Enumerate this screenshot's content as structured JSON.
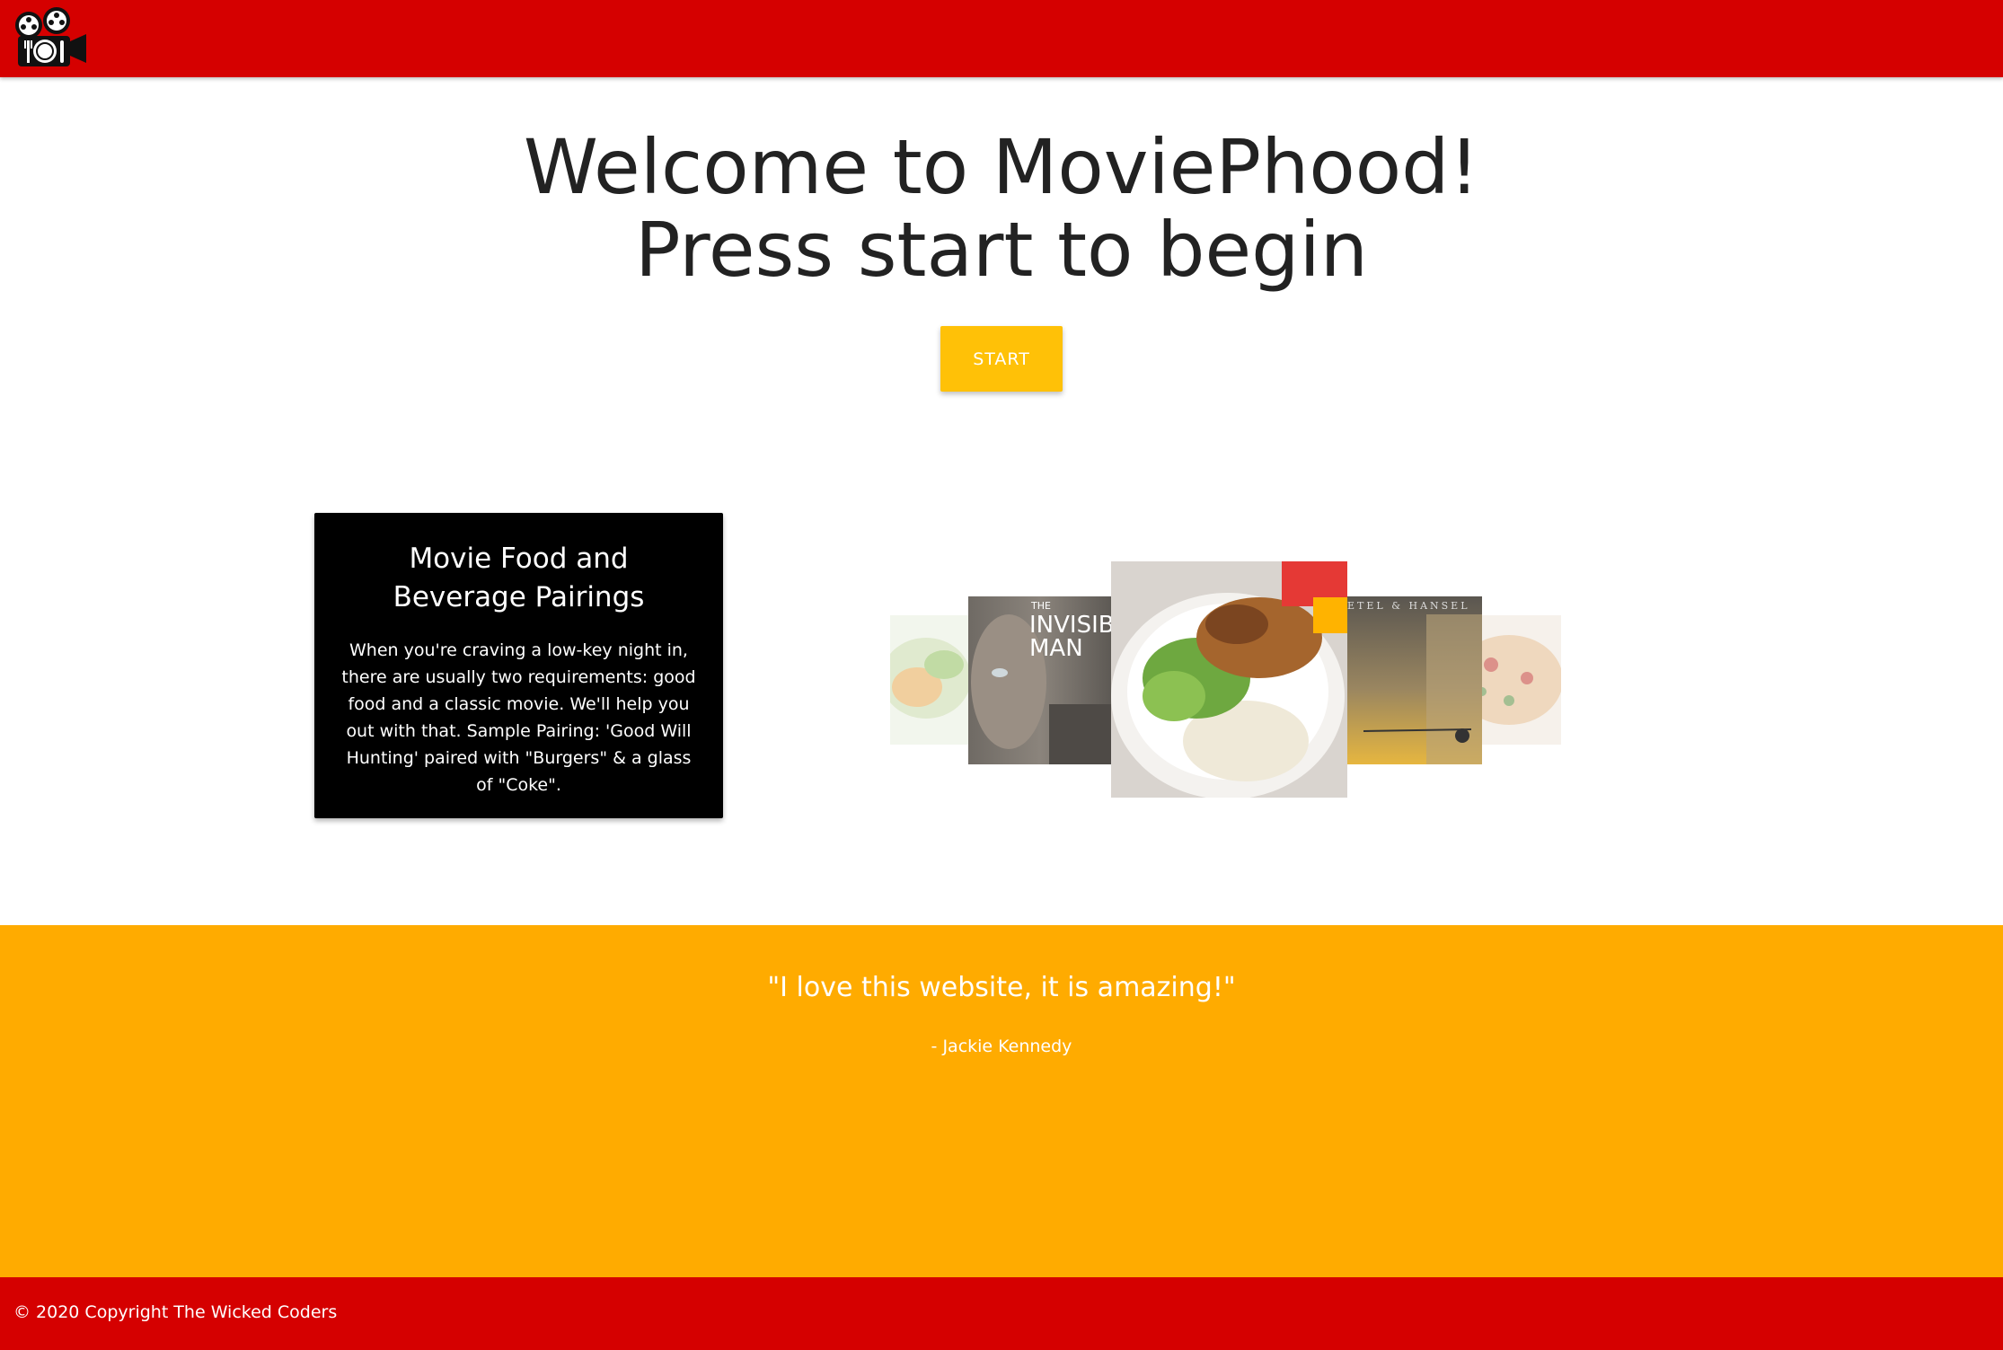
{
  "header": {
    "logo_icon": "film-projector-plate-icon",
    "background": "#d50000"
  },
  "hero": {
    "title_line1": "Welcome to MoviePhood!",
    "title_line2": "Press start to begin",
    "start_label": "START",
    "button_color": "#ffc107"
  },
  "feature": {
    "title": "Movie Food and Beverage Pairings",
    "description": "When you're craving a low-key night in, there are usually two requirements: good food and a classic movie. We'll help you out with that. Sample Pairing: 'Good Will Hunting' paired with \"Burgers\" & a glass of \"Coke\"."
  },
  "carousel": {
    "slides": [
      {
        "name": "food-salad-slide"
      },
      {
        "name": "movie-invisible-man-slide",
        "poster_text_small": "THE",
        "poster_text_1": "INVISIB",
        "poster_text_2": "MAN"
      },
      {
        "name": "food-chicken-rice-bowl-slide"
      },
      {
        "name": "movie-gretel-hansel-slide",
        "poster_text": "ETEL & HANSEL"
      },
      {
        "name": "food-pasta-slide"
      }
    ]
  },
  "testimonial": {
    "quote": "\"I love this website, it is amazing!\"",
    "author": "- Jackie Kennedy",
    "background": "#ffab00"
  },
  "footer": {
    "copyright": "© 2020 Copyright The Wicked Coders"
  }
}
